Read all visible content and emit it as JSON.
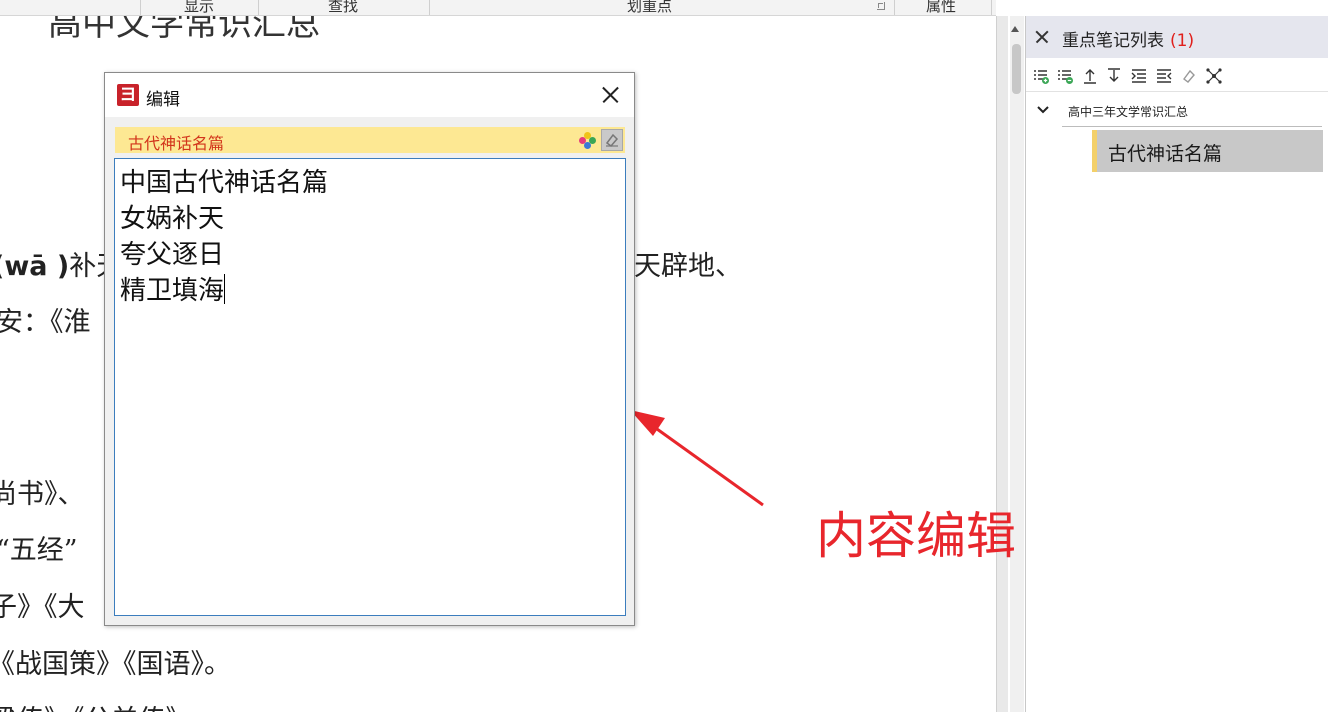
{
  "ribbon": {
    "groups": [
      "显示",
      "查找",
      "划重点",
      "属性"
    ]
  },
  "document": {
    "title": "高中文学常识汇总",
    "lines": [
      {
        "bold": "(wā )",
        "text": "补天"
      },
      {
        "bold": "",
        "text": "安：《淮"
      },
      {
        "bold": "",
        "text": "尚书》、"
      },
      {
        "bold": "",
        "text": "“五经”"
      },
      {
        "bold": "",
        "text": "子》《大"
      },
      {
        "bold": "",
        "text": "《战国策》《国语》。"
      },
      {
        "bold": "",
        "text": "梁传》《公羊传》"
      }
    ],
    "right_fragment": "天辟地、"
  },
  "dialog": {
    "title": "编辑",
    "app_icon_letter": "ヨ",
    "note_title": "古代神话名篇",
    "content": [
      "中国古代神话名篇",
      "女娲补天",
      "夸父逐日",
      "精卫填海"
    ],
    "icons": {
      "close": "close-icon",
      "color": "color-palette-icon",
      "eraser": "eraser-icon"
    }
  },
  "annotation": {
    "label": "内容编辑",
    "color": "#e8262c"
  },
  "notes_panel": {
    "title": "重点笔记列表",
    "count": "(1)",
    "toolbar_icons": [
      "add-note-icon",
      "remove-note-icon",
      "move-up-icon",
      "move-down-icon",
      "indent-icon",
      "outdent-icon",
      "eraser-icon",
      "expand-icon"
    ],
    "document_node": "高中三年文学常识汇总",
    "note_item": "古代神话名篇"
  },
  "colors": {
    "accent_red": "#c8222a",
    "note_yellow": "#fde893",
    "note_title_red": "#d2341b"
  }
}
